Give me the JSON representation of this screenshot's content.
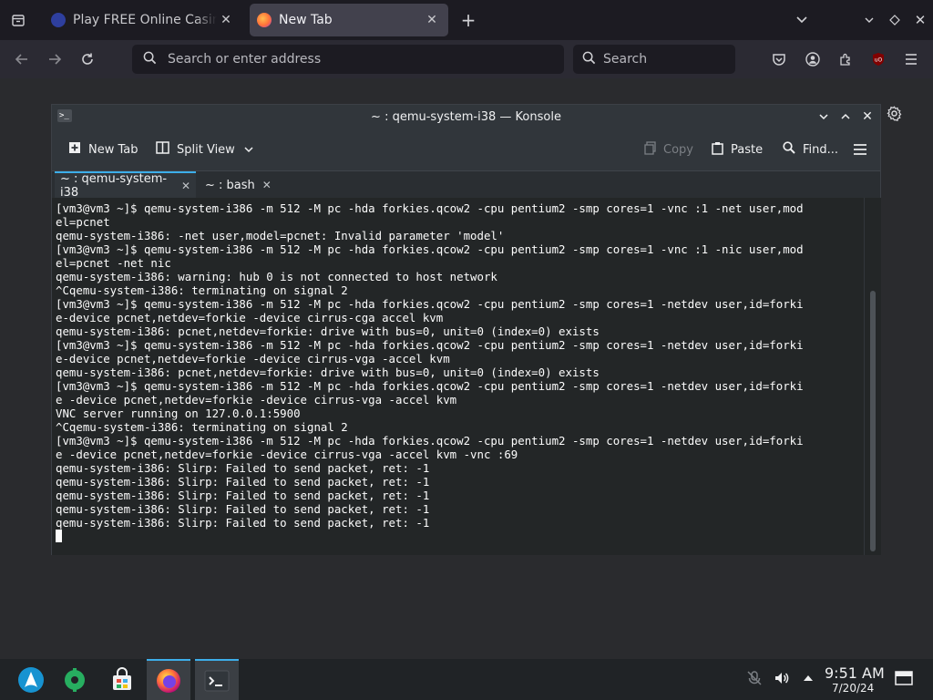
{
  "browser": {
    "tabs": [
      {
        "title": "Play FREE Online Casino g",
        "active": false
      },
      {
        "title": "New Tab",
        "active": true
      }
    ],
    "new_tab_glyph": "+",
    "url_placeholder": "Search or enter address",
    "search_placeholder": "Search"
  },
  "konsole": {
    "window_title": "~ : qemu-system-i38 — Konsole",
    "toolbar": {
      "new_tab": "New Tab",
      "split_view": "Split View",
      "copy": "Copy",
      "paste": "Paste",
      "find": "Find..."
    },
    "tabs": [
      {
        "label": "~ : qemu-system-i38",
        "active": true
      },
      {
        "label": "~ : bash",
        "active": false
      }
    ],
    "terminal_lines": [
      "[vm3@vm3 ~]$ qemu-system-i386 -m 512 -M pc -hda forkies.qcow2 -cpu pentium2 -smp cores=1 -vnc :1 -net user,mod",
      "el=pcnet",
      "qemu-system-i386: -net user,model=pcnet: Invalid parameter 'model'",
      "[vm3@vm3 ~]$ qemu-system-i386 -m 512 -M pc -hda forkies.qcow2 -cpu pentium2 -smp cores=1 -vnc :1 -nic user,mod",
      "el=pcnet -net nic",
      "qemu-system-i386: warning: hub 0 is not connected to host network",
      "^Cqemu-system-i386: terminating on signal 2",
      "[vm3@vm3 ~]$ qemu-system-i386 -m 512 -M pc -hda forkies.qcow2 -cpu pentium2 -smp cores=1 -netdev user,id=forki",
      "e-device pcnet,netdev=forkie -device cirrus-cga accel kvm",
      "qemu-system-i386: pcnet,netdev=forkie: drive with bus=0, unit=0 (index=0) exists",
      "[vm3@vm3 ~]$ qemu-system-i386 -m 512 -M pc -hda forkies.qcow2 -cpu pentium2 -smp cores=1 -netdev user,id=forki",
      "e-device pcnet,netdev=forkie -device cirrus-vga -accel kvm",
      "qemu-system-i386: pcnet,netdev=forkie: drive with bus=0, unit=0 (index=0) exists",
      "[vm3@vm3 ~]$ qemu-system-i386 -m 512 -M pc -hda forkies.qcow2 -cpu pentium2 -smp cores=1 -netdev user,id=forki",
      "e -device pcnet,netdev=forkie -device cirrus-vga -accel kvm",
      "VNC server running on 127.0.0.1:5900",
      "^Cqemu-system-i386: terminating on signal 2",
      "[vm3@vm3 ~]$ qemu-system-i386 -m 512 -M pc -hda forkies.qcow2 -cpu pentium2 -smp cores=1 -netdev user,id=forki",
      "e -device pcnet,netdev=forkie -device cirrus-vga -accel kvm -vnc :69",
      "qemu-system-i386: Slirp: Failed to send packet, ret: -1",
      "qemu-system-i386: Slirp: Failed to send packet, ret: -1",
      "qemu-system-i386: Slirp: Failed to send packet, ret: -1",
      "qemu-system-i386: Slirp: Failed to send packet, ret: -1",
      "qemu-system-i386: Slirp: Failed to send packet, ret: -1"
    ]
  },
  "taskbar": {
    "time": "9:51 AM",
    "date": "7/20/24"
  },
  "colors": {
    "accent": "#3daee9",
    "terminal_bg": "#232627",
    "terminal_fg": "#fcfcfc"
  }
}
